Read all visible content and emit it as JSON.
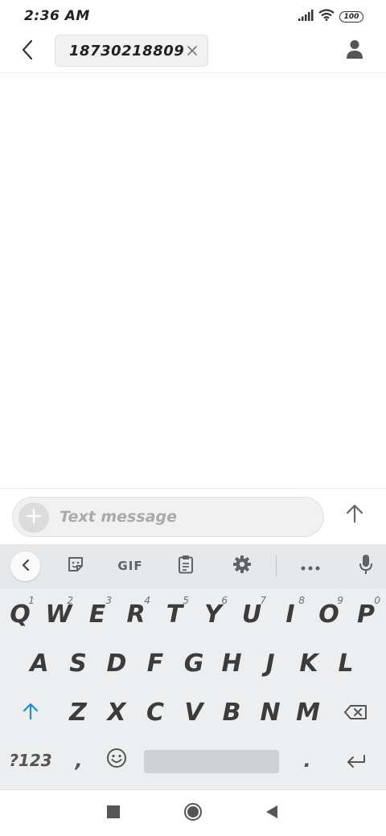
{
  "status_bar": {
    "time": "2:36 AM",
    "battery": "100",
    "icons": [
      "signal-icon",
      "wifi-icon",
      "battery-icon"
    ]
  },
  "header": {
    "recipient": "18730218809",
    "icons": [
      "back-arrow-icon",
      "close-icon",
      "contact-icon"
    ]
  },
  "compose": {
    "placeholder": "Text message",
    "icons": [
      "add-icon",
      "send-arrow-icon"
    ]
  },
  "keyboard": {
    "toolbar": {
      "gif_label": "GIF",
      "icons": [
        "chevron-left-icon",
        "sticker-icon",
        "clipboard-icon",
        "gear-icon",
        "more-dots-icon",
        "microphone-icon"
      ]
    },
    "row1": [
      {
        "label": "Q",
        "hint": "1"
      },
      {
        "label": "W",
        "hint": "2"
      },
      {
        "label": "E",
        "hint": "3"
      },
      {
        "label": "R",
        "hint": "4"
      },
      {
        "label": "T",
        "hint": "5"
      },
      {
        "label": "Y",
        "hint": "6"
      },
      {
        "label": "U",
        "hint": "7"
      },
      {
        "label": "I",
        "hint": "8"
      },
      {
        "label": "O",
        "hint": "9"
      },
      {
        "label": "P",
        "hint": "0"
      }
    ],
    "row2": [
      "A",
      "S",
      "D",
      "F",
      "G",
      "H",
      "J",
      "K",
      "L"
    ],
    "row3": [
      "Z",
      "X",
      "C",
      "V",
      "B",
      "N",
      "M"
    ],
    "symbols_label": "?123",
    "comma_label": ",",
    "period_label": ".",
    "icons": [
      "shift-arrow-icon",
      "backspace-icon",
      "emoji-icon",
      "enter-icon"
    ]
  },
  "colors": {
    "accent_blue": "#1a8fe0",
    "key_text": "#3c3c3c",
    "keyboard_bg": "#eceef0"
  },
  "navbar": {
    "icons": [
      "recent-apps-icon",
      "home-icon",
      "back-triangle-icon"
    ]
  }
}
